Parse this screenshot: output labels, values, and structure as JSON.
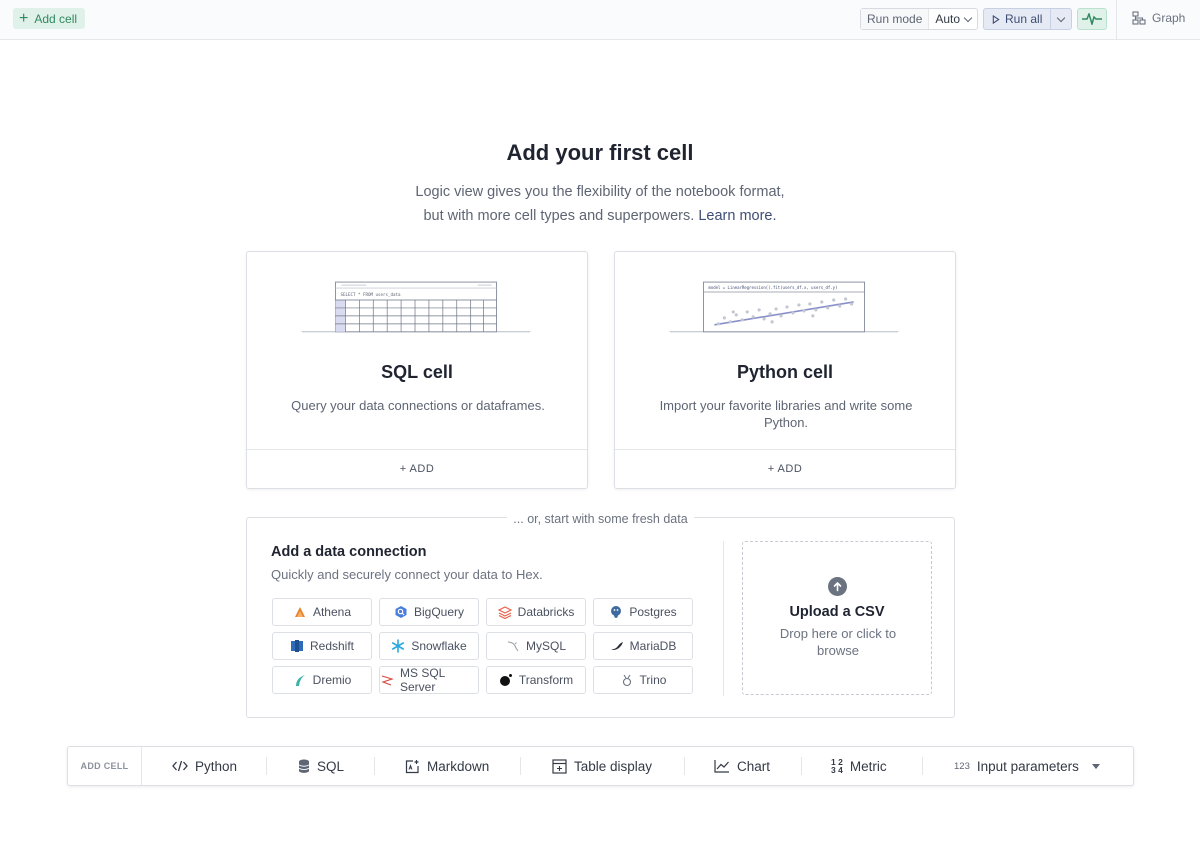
{
  "topbar": {
    "add_cell": "Add cell",
    "run_mode_label": "Run mode",
    "run_mode_value": "Auto",
    "run_all": "Run all",
    "graph": "Graph"
  },
  "hero": {
    "title": "Add your first cell",
    "line1": "Logic view gives you the flexibility of the notebook format,",
    "line2": "but with more cell types and superpowers.",
    "learn_more": "Learn more."
  },
  "cards": {
    "sql": {
      "title": "SQL cell",
      "desc": "Query your data connections or dataframes.",
      "add": "+ ADD"
    },
    "python": {
      "title": "Python cell",
      "desc": "Import your favorite libraries and write some Python.",
      "add": "+ ADD"
    }
  },
  "fresh": {
    "legend": "... or, start with some fresh data",
    "title": "Add a data connection",
    "subtitle": "Quickly and securely connect your data to Hex.",
    "connections": [
      {
        "label": "Athena",
        "icon": "athena-icon",
        "color": "#e8832c"
      },
      {
        "label": "BigQuery",
        "icon": "bigquery-icon",
        "color": "#4a7fe0"
      },
      {
        "label": "Databricks",
        "icon": "databricks-icon",
        "color": "#e8604a"
      },
      {
        "label": "Postgres",
        "icon": "postgres-icon",
        "color": "#3e6a9e"
      },
      {
        "label": "Redshift",
        "icon": "redshift-icon",
        "color": "#2f6bb8"
      },
      {
        "label": "Snowflake",
        "icon": "snowflake-icon",
        "color": "#29a9df"
      },
      {
        "label": "MySQL",
        "icon": "mysql-icon",
        "color": "#9aa0aa"
      },
      {
        "label": "MariaDB",
        "icon": "mariadb-icon",
        "color": "#2b2f38"
      },
      {
        "label": "Dremio",
        "icon": "dremio-icon",
        "color": "#3bb3a8"
      },
      {
        "label": "MS SQL Server",
        "icon": "mssql-icon",
        "color": "#d6453c"
      },
      {
        "label": "Transform",
        "icon": "transform-icon",
        "color": "#111111"
      },
      {
        "label": "Trino",
        "icon": "trino-icon",
        "color": "#6b7280"
      }
    ],
    "upload_title": "Upload a CSV",
    "upload_desc": "Drop here or click to browse"
  },
  "addbar": {
    "label": "ADD CELL",
    "python": "Python",
    "sql": "SQL",
    "markdown": "Markdown",
    "table_display": "Table display",
    "chart": "Chart",
    "metric": "Metric",
    "input_parameters": "Input parameters",
    "input_parameters_glyph": "123",
    "metric_glyph_top": "1 2",
    "metric_glyph_bottom": "3 4"
  },
  "illustrations": {
    "sql_query": "SELECT * FROM users_data",
    "python_code": "model = LinearRegression().fit(users_df.x, users_df.y)"
  },
  "colors": {
    "accent_green": "#2f8a5f",
    "accent_blue": "#3e4d73",
    "border": "#dcdfe4"
  }
}
